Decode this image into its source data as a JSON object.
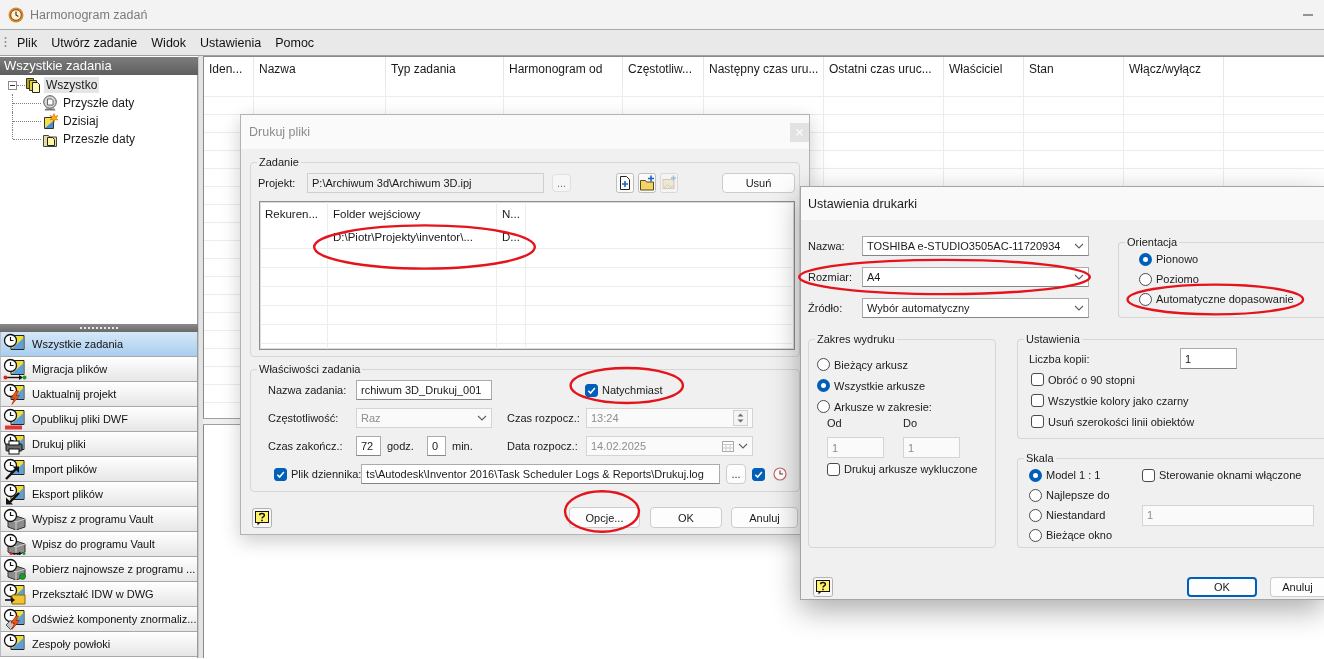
{
  "window": {
    "title": "Harmonogram zadań"
  },
  "menu": [
    {
      "label": "Plik"
    },
    {
      "label": "Utwórz zadanie"
    },
    {
      "label": "Widok"
    },
    {
      "label": "Ustawienia"
    },
    {
      "label": "Pomoc"
    }
  ],
  "sidebar": {
    "header": "Wszystkie zadania",
    "tree": [
      {
        "label": "Wszystko",
        "selected": true,
        "expanded": true,
        "children": [
          {
            "label": "Przyszłe daty",
            "selected": false
          },
          {
            "label": "Dzisiaj",
            "selected": false
          },
          {
            "label": "Przeszłe daty",
            "selected": false
          }
        ]
      }
    ],
    "task_types": [
      {
        "label": "Wszystkie zadania",
        "selected": true
      },
      {
        "label": "Migracja plików",
        "selected": false
      },
      {
        "label": "Uaktualnij projekt",
        "selected": false
      },
      {
        "label": "Opublikuj pliki DWF",
        "selected": false
      },
      {
        "label": "Drukuj pliki",
        "selected": false
      },
      {
        "label": "Import plików",
        "selected": false
      },
      {
        "label": "Eksport plików",
        "selected": false
      },
      {
        "label": "Wypisz z programu Vault",
        "selected": false
      },
      {
        "label": "Wpisz do programu Vault",
        "selected": false
      },
      {
        "label": "Pobierz najnowsze z programu ...",
        "selected": false
      },
      {
        "label": "Przekształć IDW w DWG",
        "selected": false
      },
      {
        "label": "Odśwież komponenty znormaliz...",
        "selected": false
      },
      {
        "label": "Zespoły powłoki",
        "selected": false
      }
    ]
  },
  "table": {
    "columns": [
      "Iden...",
      "Nazwa",
      "Typ zadania",
      "Harmonogram od",
      "Częstotliw...",
      "Następny czas uru...",
      "Ostatni czas uruc...",
      "Właściciel",
      "Stan",
      "Włącz/wyłącz"
    ]
  },
  "print_dialog": {
    "title": "Drukuj pliki",
    "task": {
      "legend": "Zadanie",
      "project_label": "Projekt:",
      "project": {
        "value": "P:\\Archiwum 3d\\Archiwum 3D.ipj",
        "readonly": true
      },
      "browse_button": "...",
      "tool_buttons": [
        {
          "disabled": false
        },
        {
          "disabled": false
        },
        {
          "disabled": true
        }
      ],
      "delete_button": "Usuń",
      "files": {
        "columns": [
          "Rekuren...",
          "Folder wejściowy",
          "N..."
        ],
        "rows": [
          {
            "folder": "D:\\Piotr\\Projekty\\inventor\\...",
            "column_3": "D...",
            "circled": true
          }
        ]
      }
    },
    "properties": {
      "legend": "Właściwości zadania",
      "name_label": "Nazwa zadania:",
      "name": {
        "value": "rchiwum 3D_Drukuj_001",
        "disabled": false
      },
      "immediate": {
        "label": "Natychmiast",
        "checked": true,
        "circled": true
      },
      "frequency_label": "Częstotliwość:",
      "frequency": {
        "value": "Raz",
        "disabled": true
      },
      "start_time_label": "Czas rozpocz.:",
      "start_time": {
        "value": "13:24",
        "disabled": true
      },
      "end_label": "Czas zakończ.:",
      "end_hours": {
        "value": "72",
        "disabled": false
      },
      "hours_unit": "godz.",
      "end_minutes": {
        "value": "0",
        "disabled": false
      },
      "minutes_unit": "min.",
      "start_date_label": "Data rozpocz.:",
      "start_date": {
        "value": "14.02.2025",
        "disabled": true
      },
      "log": {
        "label": "Plik dziennika:",
        "checked": true,
        "value": "ts\\Autodesk\\Inventor 2016\\Task Scheduler Logs & Reports\\Drukuj.log",
        "browse_button": "...",
        "option_checked": true
      }
    },
    "buttons": [
      {
        "label": "Opcje...",
        "default": false,
        "circled": true
      },
      {
        "label": "OK",
        "default": false,
        "circled": false
      },
      {
        "label": "Anuluj",
        "default": false,
        "circled": false
      }
    ]
  },
  "printer_dialog": {
    "title": "Ustawienia drukarki",
    "selects": [
      {
        "label": "Nazwa:",
        "value": "TOSHIBA e-STUDIO3505AC-11720934",
        "circled": false
      },
      {
        "label": "Rozmiar:",
        "value": "A4",
        "circled": true
      },
      {
        "label": "Źródło:",
        "value": "Wybór automatyczny",
        "circled": false
      }
    ],
    "orientation": {
      "legend": "Orientacja",
      "options": [
        {
          "label": "Pionowo",
          "selected": true,
          "circled": false
        },
        {
          "label": "Poziomo",
          "selected": false,
          "circled": false
        },
        {
          "label": "Automatyczne dopasowanie",
          "selected": false,
          "circled": true
        }
      ]
    },
    "print_range": {
      "legend": "Zakres wydruku",
      "options": [
        {
          "label": "Bieżący arkusz",
          "selected": false
        },
        {
          "label": "Wszystkie arkusze",
          "selected": true
        },
        {
          "label": "Arkusze w zakresie:",
          "selected": false
        }
      ],
      "from_label": "Od",
      "to_label": "Do",
      "from": {
        "value": "1",
        "disabled": true
      },
      "to": {
        "value": "1",
        "disabled": true
      },
      "excluded": {
        "label": "Drukuj arkusze wykluczone",
        "checked": false
      }
    },
    "settings": {
      "legend": "Ustawienia",
      "copies_label": "Liczba kopii:",
      "copies": {
        "value": "1",
        "disabled": false
      },
      "options": [
        {
          "label": "Obróć o 90 stopni",
          "checked": false
        },
        {
          "label": "Wszystkie kolory jako czarny",
          "checked": false
        },
        {
          "label": "Usuń szerokości linii obiektów",
          "checked": false
        }
      ]
    },
    "scale": {
      "legend": "Skala",
      "options": [
        {
          "label": "Model 1 : 1",
          "selected": true
        },
        {
          "label": "Najlepsze do",
          "selected": false
        },
        {
          "label": "Niestandard",
          "selected": false
        },
        {
          "label": "Bieżące okno",
          "selected": false
        }
      ],
      "viewport_control": {
        "label": "Sterowanie oknami włączone",
        "checked": false
      },
      "custom_scale": {
        "value": "1",
        "disabled": true
      }
    },
    "buttons": [
      {
        "label": "OK",
        "default": true
      },
      {
        "label": "Anuluj",
        "default": false
      }
    ]
  }
}
